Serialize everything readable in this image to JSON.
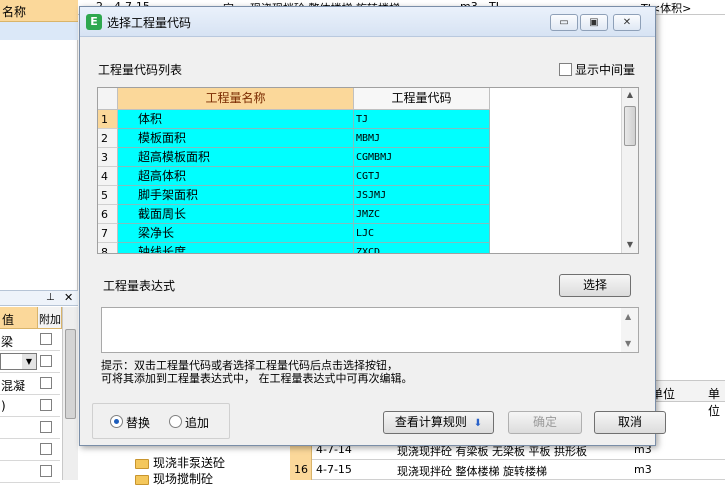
{
  "background": {
    "top_row": {
      "num": "2",
      "code": "4-7-15",
      "type": "定",
      "name": "现浇现拌砼 整体楼梯 旋转楼梯",
      "unit": "m3",
      "expr": "TJ",
      "expr2": "TJ<体积>"
    },
    "left_header": "名称",
    "left_panel": {
      "col_value": "值",
      "col_add": "附加",
      "rows": [
        "梁",
        "",
        "混凝",
        ")",
        "",
        "",
        ""
      ]
    },
    "tree_items": [
      "现浇非泵送砼",
      "现场搅制砼"
    ],
    "grid_rows": [
      {
        "num": "",
        "code": "4-7-14",
        "name": "现浇现拌砼 有梁板 无梁板 平板 拱形板",
        "unit": "m3"
      },
      {
        "num": "16",
        "code": "4-7-15",
        "name": "现浇现拌砼 整体楼梯 旋转楼梯",
        "unit": "m3"
      }
    ],
    "right_header": {
      "unit": "单位",
      "unit2": "单位"
    }
  },
  "dialog": {
    "title": "选择工程量代码",
    "app_icon": "glodon-app-icon",
    "code_list_label": "工程量代码列表",
    "show_intermediate_label": "显示中间量",
    "show_intermediate_checked": false,
    "columns": {
      "name": "工程量名称",
      "code": "工程量代码"
    },
    "rows": [
      {
        "num": "1",
        "name": "体积",
        "code": "TJ"
      },
      {
        "num": "2",
        "name": "模板面积",
        "code": "MBMJ"
      },
      {
        "num": "3",
        "name": "超高模板面积",
        "code": "CGMBMJ"
      },
      {
        "num": "4",
        "name": "超高体积",
        "code": "CGTJ"
      },
      {
        "num": "5",
        "name": "脚手架面积",
        "code": "JSJMJ"
      },
      {
        "num": "6",
        "name": "截面周长",
        "code": "JMZC"
      },
      {
        "num": "7",
        "name": "梁净长",
        "code": "LJC"
      },
      {
        "num": "8",
        "name": "轴线长度",
        "code": "ZXCD"
      }
    ],
    "expression_label": "工程量表达式",
    "select_button": "选择",
    "expression_value": "",
    "hint_line1": "提示：双击工程量代码或者选择工程量代码后点击选择按钮，",
    "hint_line2": "可将其添加到工程量表达式中， 在工程量表达式中可再次编辑。",
    "radio_replace": "替换",
    "radio_append": "追加",
    "radio_selected": "替换",
    "view_rules_button": "查看计算规则",
    "confirm_button": "确定",
    "cancel_button": "取消"
  }
}
